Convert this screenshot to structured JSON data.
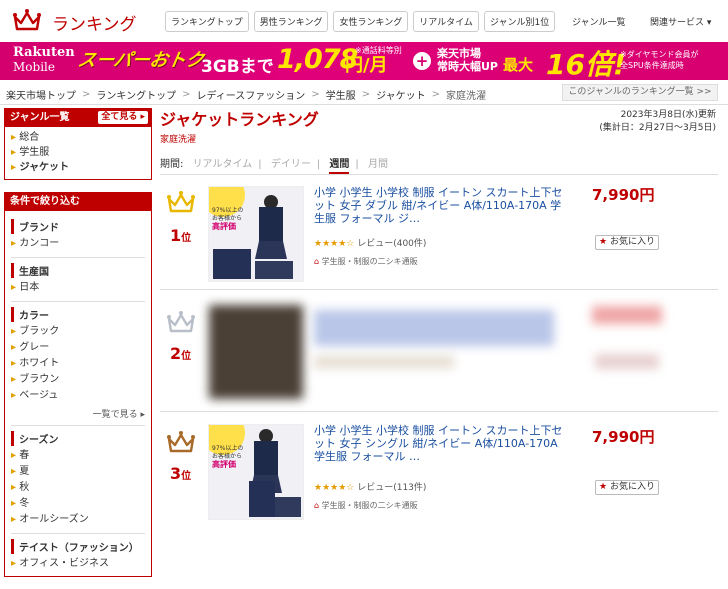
{
  "header": {
    "logo_text": "ランキング",
    "nav": [
      "ランキングトップ",
      "男性ランキング",
      "女性ランキング",
      "リアルタイム",
      "ジャンル別1位"
    ],
    "genre_list": "ジャンル一覧",
    "related": "関連サービス ▾"
  },
  "banner": {
    "brand_line1": "Rakuten",
    "brand_line2": "Mobile",
    "super_deal": "スーパーおトク",
    "gb": "3GBまで",
    "price": "1,078",
    "unit": "円/月",
    "note1": "※通話料等別",
    "market_line1": "楽天市場",
    "market_line2": "常時大幅UP",
    "max": "最大",
    "times": "16倍!",
    "note2_line1": "※ダイヤモンド会員が",
    "note2_line2": "全SPU条件達成時"
  },
  "breadcrumb": [
    "楽天市場トップ",
    "ランキングトップ",
    "レディースファッション",
    "学生服",
    "ジャケット",
    "家庭洗濯"
  ],
  "genre_ranking_list": "このジャンルのランキング一覧 >>",
  "sidebar": {
    "genre_box": {
      "title": "ジャンル一覧",
      "btn": "全て見る ▸",
      "items": [
        "総合",
        "学生服",
        "ジャケット"
      ]
    },
    "filter_box": {
      "title": "条件で絞り込む",
      "sections": [
        {
          "name": "ブランド",
          "items": [
            "カンコー"
          ]
        },
        {
          "name": "生産国",
          "items": [
            "日本"
          ]
        },
        {
          "name": "カラー",
          "items": [
            "ブラック",
            "グレー",
            "ホワイト",
            "ブラウン",
            "ベージュ"
          ],
          "more": "一覧で見る ▸"
        },
        {
          "name": "シーズン",
          "items": [
            "春",
            "夏",
            "秋",
            "冬",
            "オールシーズン"
          ]
        },
        {
          "name": "テイスト（ファッション）",
          "items": [
            "オフィス・ビジネス"
          ]
        }
      ]
    }
  },
  "main": {
    "title": "ジャケットランキング",
    "subgenre": "家庭洗濯",
    "updated": "2023年3月8日(水)更新",
    "period_range": "(集計日：2月27日～3月5日)",
    "period": {
      "label": "期間:",
      "options": [
        "リアルタイム",
        "デイリー",
        "週間",
        "月間"
      ],
      "active": "週間"
    },
    "items": [
      {
        "rank": "1",
        "rank_suffix": "位",
        "title": "小学 小学生 小学校 制服 イートン スカート上下セット 女子 ダブル 紺/ネイビー A体/110A-170A 学生服 フォーマル ジ…",
        "stars": "★★★★☆",
        "review": "レビュー(400件)",
        "shop": "学生服・制服の二シキ通販",
        "price": "7,990円",
        "fav": "お気に入り",
        "img_badge_top": "97%以上の",
        "img_badge_mid": "お客様から",
        "img_badge_bot": "高評価",
        "crown_color": "#e8b800"
      },
      {
        "rank": "2",
        "rank_suffix": "位",
        "crown_color": "#b9bfc8"
      },
      {
        "rank": "3",
        "rank_suffix": "位",
        "title": "小学 小学生 小学校 制服 イートン スカート上下セット 女子 シングル 紺/ネイビー A体/110A-170A 学生服 フォーマル …",
        "stars": "★★★★☆",
        "review": "レビュー(113件)",
        "shop": "学生服・制服の二シキ通販",
        "price": "7,990円",
        "fav": "お気に入り",
        "img_badge_top": "97%以上の",
        "img_badge_mid": "お客様から",
        "img_badge_bot": "高評価",
        "crown_color": "#a86a2a"
      }
    ]
  },
  "colors": {
    "accent": "#bf0000",
    "banner": "#d4006e",
    "link": "#1a4fa0"
  }
}
